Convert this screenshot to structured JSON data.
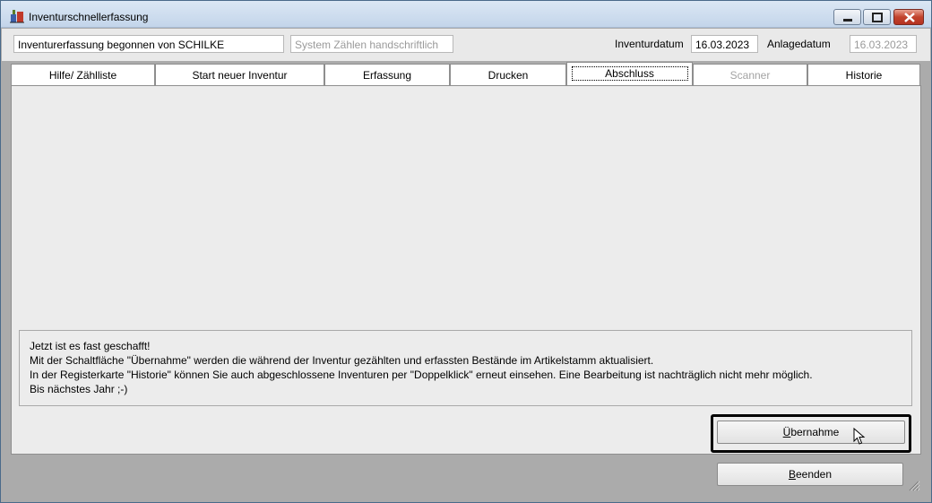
{
  "window": {
    "title": "Inventurschnellerfassung",
    "controls": [
      "minimize-icon",
      "maximize-icon",
      "close-icon"
    ]
  },
  "info": {
    "started_by": "Inventurerfassung begonnen von SCHILKE",
    "mode": "System Zählen handschriftlich",
    "inventory_date_label": "Inventurdatum",
    "inventory_date": "16.03.2023",
    "creation_date_label": "Anlagedatum",
    "creation_date": "16.03.2023"
  },
  "tabs": [
    {
      "label": "Hilfe/ Zählliste",
      "state": "normal"
    },
    {
      "label": "Start neuer Inventur",
      "state": "normal"
    },
    {
      "label": "Erfassung",
      "state": "normal"
    },
    {
      "label": "Drucken",
      "state": "normal"
    },
    {
      "label": "Abschluss",
      "state": "active"
    },
    {
      "label": "Scanner",
      "state": "disabled"
    },
    {
      "label": "Historie",
      "state": "normal"
    }
  ],
  "message": {
    "lines": [
      "Jetzt ist es fast geschafft!",
      "Mit der Schaltfläche \"Übernahme\" werden die während der Inventur gezählten und erfassten Bestände im Artikelstamm aktualisiert.",
      "In der Registerkarte \"Historie\" können Sie auch abgeschlossene Inventuren per \"Doppelklick\" erneut einsehen. Eine Bearbeitung ist nachträglich nicht mehr möglich.",
      "Bis nächstes Jahr ;-)"
    ]
  },
  "buttons": {
    "apply": {
      "mnemonic": "Ü",
      "rest": "bernahme"
    },
    "exit": {
      "mnemonic": "B",
      "rest": "eenden"
    }
  },
  "colors": {
    "window_bg": "#ababab",
    "tab_page_bg": "#ececec",
    "disabled_text": "#a3a3a3"
  }
}
